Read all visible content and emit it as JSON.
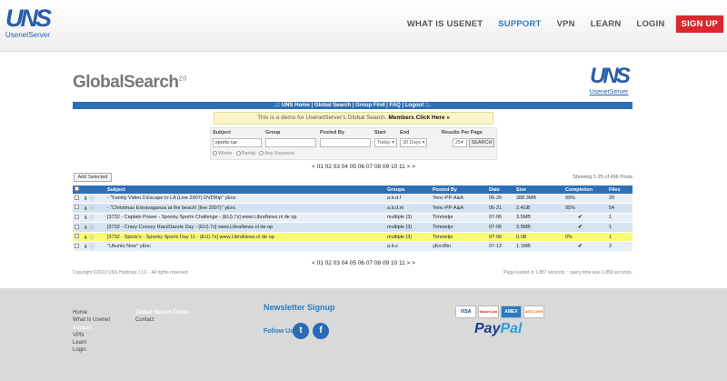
{
  "brand": {
    "logo_mark": "UNS",
    "logo_text": "UsenetServer"
  },
  "nav": {
    "items": [
      {
        "label": "WHAT IS USENET"
      },
      {
        "label": "SUPPORT"
      },
      {
        "label": "VPN"
      },
      {
        "label": "LEARN"
      },
      {
        "label": "LOGIN"
      }
    ],
    "signup_label": "SIGN UP",
    "active_color": "#2a7bc1",
    "signup_color": "#d9282e"
  },
  "page": {
    "title": "GlobalSearch",
    "version": "2.0",
    "right_logo_mark": "UNS",
    "right_logo_text": "UsenetServer"
  },
  "menu_bar": {
    "text": ".:: UNS Home | Global Search | Group Find | FAQ | Logout ::."
  },
  "demo_notice": {
    "text": "This is a demo for UsenetServer's Global Search.",
    "link": "Members Click Here »"
  },
  "search_form": {
    "subject_label": "Subject",
    "subject_value": "sports car",
    "group_label": "Group",
    "group_value": "",
    "posted_by_label": "Posted By",
    "posted_by_value": "",
    "start_label": "Start",
    "start_value": "Today",
    "end_label": "End",
    "end_value": "30 Days",
    "rpp_label": "Results Per Page",
    "rpp_value": "25",
    "search_button": "SEARCH",
    "match_options": [
      "Whole",
      "Partial",
      "Any Keyword"
    ]
  },
  "pagination": {
    "text": "< 01 02 03 04 05 06 07 08 09 10 11 >  >"
  },
  "add_selected_label": "Add Selected",
  "showing_text": "Showing 1-25 of 496 Posts",
  "table": {
    "columns": [
      "Subject",
      "Groups",
      "Posted By",
      "Date",
      "Size",
      "Completion",
      "Files"
    ],
    "rows": [
      {
        "subject": "- \"Family Video 3 Escape to LA (Live 2007) DVDRip\" yEnc",
        "groups": "a.b.d.f",
        "posted_by": "Yenc-PP-A&A",
        "date": "06-26",
        "size": "388.3MB",
        "completion": "99%",
        "files": "29"
      },
      {
        "subject": "- \"Christmas Extravaganza at the beach! (live 2007)\" yEnc",
        "groups": "a.b.d.m",
        "posted_by": "Yenc-PP-A&A",
        "date": "06-21",
        "size": "2.4GB",
        "completion": "95%",
        "files": "54"
      },
      {
        "subject": "[3732 - Captain Power - Spooky Sports Challenge - (EU).7z] www.LibraNews.nl de op",
        "groups": "multiple (3)",
        "posted_by": "Timmetje",
        "date": "07-06",
        "size": "3.5MB",
        "completion": "✔",
        "files": "1"
      },
      {
        "subject": "[3732 - Crazy Coocey RazzDazzle Day - (EU).7z] www.LibraNews.nl de op",
        "groups": "multiple (3)",
        "posted_by": "Timmetje",
        "date": "07-06",
        "size": "3.5MB",
        "completion": "✔",
        "files": "1"
      },
      {
        "subject": "[3732 - Spock's - Spooky Sports Day 11 - (EU).7z] www.LibraNews.nl de op",
        "groups": "multiple (3)",
        "posted_by": "Timmetje",
        "date": "07-06",
        "size": "0.0B",
        "completion": "0%",
        "files": "1"
      },
      {
        "subject": "\"Ubuntu Now\" yEnc",
        "groups": "a.b.x",
        "posted_by": "yEncBin",
        "date": "07-12",
        "size": "1.1MB",
        "completion": "✔",
        "files": "2"
      }
    ]
  },
  "copyright": "Copyright ©2012 UNS Holdings, LLC - All rights reserved",
  "page_load": "Page loaded in 1.887 seconds :: query time was 1.859 seconds.",
  "footer": {
    "col1": [
      "Home",
      "What Is Usenet",
      "Support",
      "VPN",
      "Learn",
      "Login"
    ],
    "col2_head": "Global Search Demo",
    "col2": [
      "Contact"
    ],
    "newsletter_title": "Newsletter Signup",
    "follow_us": "Follow Us",
    "cards": [
      "VISA",
      "MasterCard",
      "AMEX",
      "DISCOVER"
    ],
    "paypal_pay": "Pay",
    "paypal_pal": "Pal"
  }
}
